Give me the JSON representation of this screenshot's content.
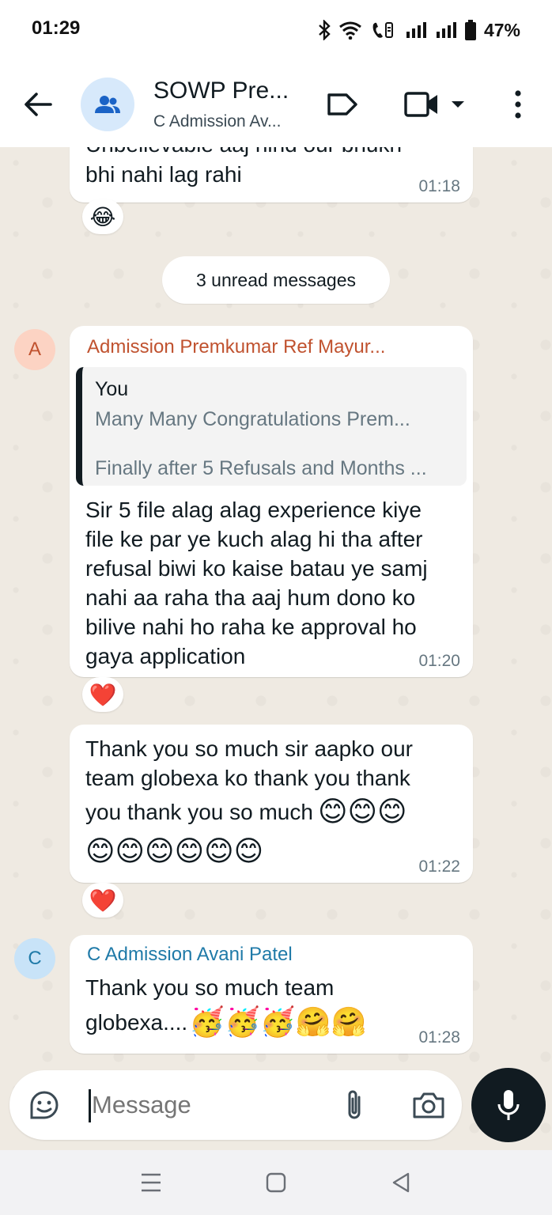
{
  "status_bar": {
    "time": "01:29",
    "battery": "47%",
    "icons": [
      "bluetooth-icon",
      "wifi-icon",
      "volte-icon",
      "signal-icon",
      "signal-icon",
      "battery-icon"
    ]
  },
  "header": {
    "title": "SOWP Pre...",
    "subtitle": "C Admission Av...",
    "icons": [
      "back-arrow-icon",
      "group-icon",
      "label-icon",
      "video-call-icon",
      "chevron-down-icon",
      "more-vert-icon"
    ]
  },
  "chat": {
    "messages": [
      {
        "text_partial": "Unbelievable aaj hind our bhukh",
        "text": "bhi nahi lag rahi",
        "time": "01:18",
        "reaction": "😂"
      }
    ],
    "unread_label": "3 unread messages",
    "message_a": {
      "avatar_letter": "A",
      "sender": "Admission Premkumar Ref Mayur...",
      "sender_color": "#c0522f",
      "avatar_bg": "#fcd3c3",
      "quote": {
        "author": "You",
        "line1": "Many Many Congratulations Prem...",
        "line2": "Finally after 5 Refusals and Months ..."
      },
      "lines": [
        "Sir 5 file  alag alag experience kiye",
        "file ke par ye kuch alag hi tha after",
        "refusal biwi ko kaise batau ye samj",
        "nahi aa raha tha aaj hum dono ko",
        "bilive nahi ho raha ke approval ho",
        "gaya application"
      ],
      "time": "01:20",
      "reaction": "❤️"
    },
    "message_b": {
      "lines": [
        "Thank you so much sir aapko our",
        "team globexa ko thank you thank",
        "you thank you so much"
      ],
      "emoji_inline": "😊😊😊",
      "emoji_line": "😊😊😊😊😊😊",
      "time": "01:22",
      "reaction": "❤️"
    },
    "message_c": {
      "avatar_letter": "C",
      "sender": "C Admission Avani Patel",
      "sender_color": "#1f7aa8",
      "avatar_bg": "#c8e3f8",
      "line1": "Thank you so much team",
      "line2": "globexa....",
      "emoji": "🥳🥳🥳🤗🤗",
      "time": "01:28"
    }
  },
  "composer": {
    "placeholder": "Message",
    "icons": [
      "sticker-icon",
      "attach-icon",
      "camera-icon",
      "mic-icon"
    ]
  },
  "nav": {
    "icons": [
      "recent-apps-icon",
      "home-icon",
      "back-icon"
    ]
  },
  "colors": {
    "chat_bg": "#efeae2",
    "bubble_bg": "#ffffff",
    "mic_bg": "#111b21"
  }
}
